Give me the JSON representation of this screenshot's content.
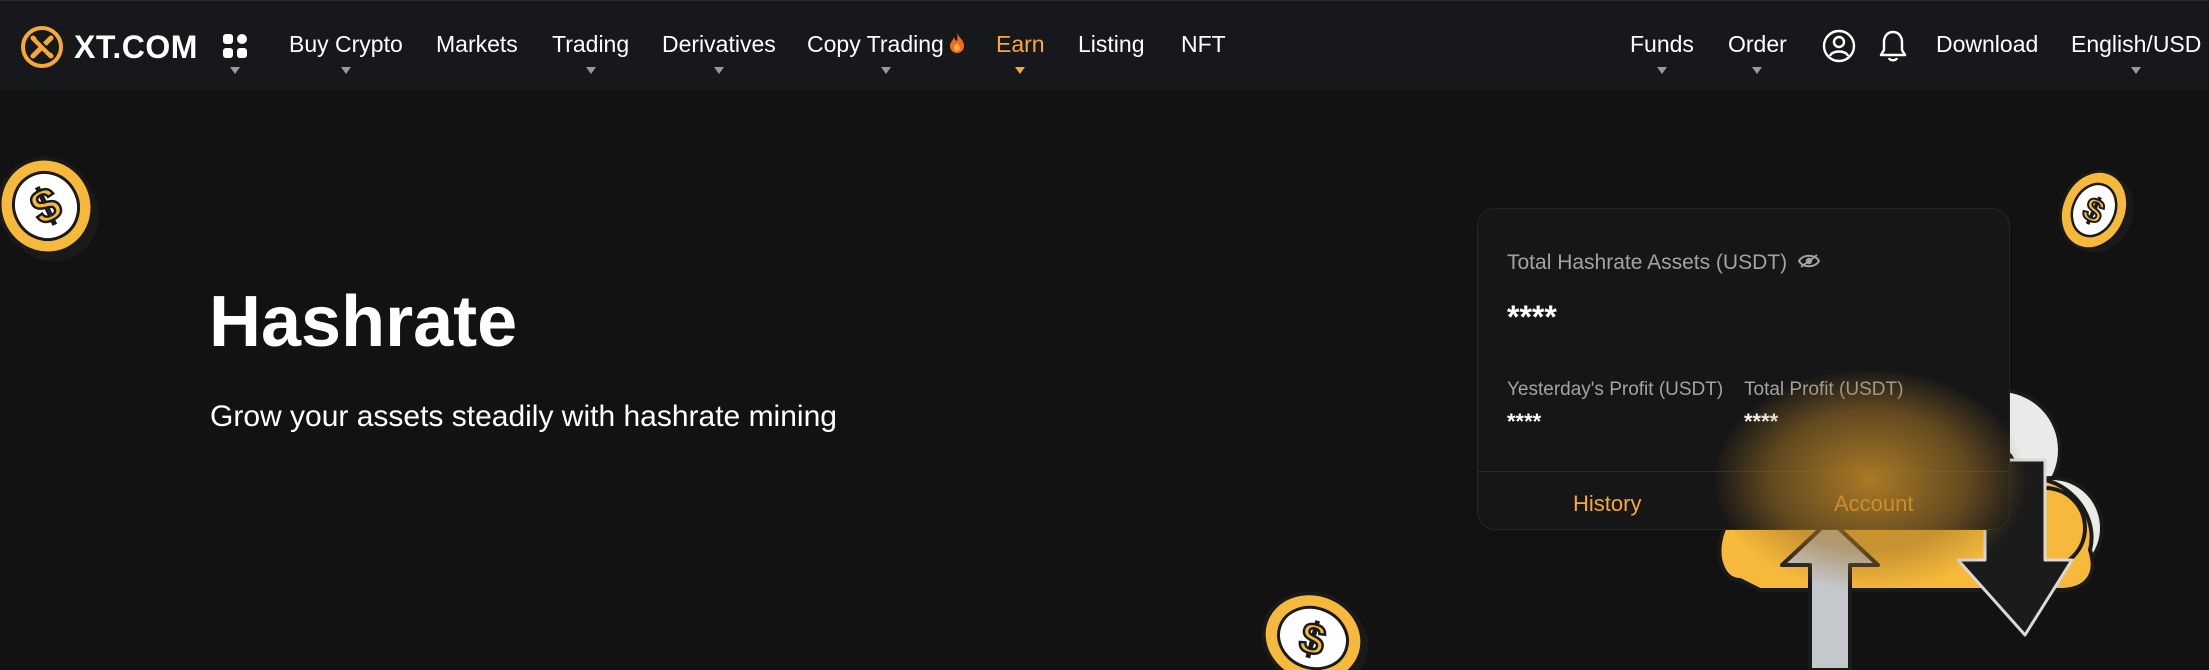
{
  "nav": {
    "logo_text": "XT.COM",
    "items": [
      {
        "label": "Buy Crypto",
        "has_dropdown": true
      },
      {
        "label": "Markets",
        "has_dropdown": false
      },
      {
        "label": "Trading",
        "has_dropdown": true
      },
      {
        "label": "Derivatives",
        "has_dropdown": true
      },
      {
        "label": "Copy Trading",
        "has_dropdown": true,
        "icon": "flame-icon"
      },
      {
        "label": "Earn",
        "has_dropdown": true,
        "active": true
      },
      {
        "label": "Listing",
        "has_dropdown": false
      },
      {
        "label": "NFT",
        "has_dropdown": false
      }
    ],
    "right": {
      "funds": "Funds",
      "order": "Order",
      "download": "Download",
      "language": "English/USD"
    },
    "icons": [
      "apps-grid-icon",
      "user-icon",
      "bell-icon"
    ]
  },
  "hero": {
    "title": "Hashrate",
    "subtitle": "Grow your assets steadily with hashrate mining"
  },
  "card": {
    "total_label": "Total Hashrate Assets (USDT)",
    "total_value": "****",
    "yesterday_label": "Yesterday's Profit (USDT)",
    "yesterday_value": "****",
    "total_profit_label": "Total Profit (USDT)",
    "total_profit_value": "****",
    "history_link": "History",
    "account_link": "Account"
  },
  "colors": {
    "background": "#121212",
    "nav_background": "#17181b",
    "accent": "#f7a836",
    "coin_gold": "#f6b93b"
  }
}
